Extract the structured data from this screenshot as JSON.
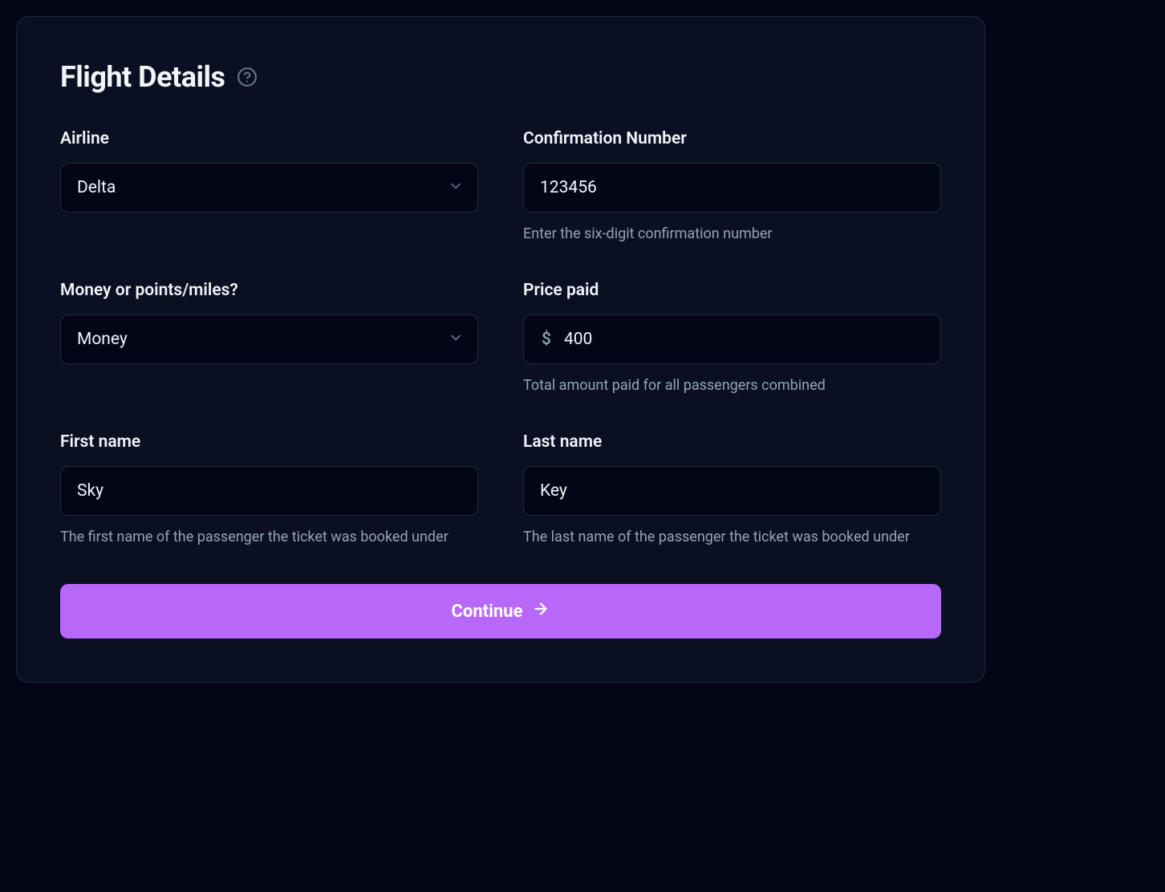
{
  "header": {
    "title": "Flight Details"
  },
  "fields": {
    "airline": {
      "label": "Airline",
      "value": "Delta"
    },
    "confirmation": {
      "label": "Confirmation Number",
      "value": "123456",
      "help": "Enter the six-digit confirmation number"
    },
    "payment_type": {
      "label": "Money or points/miles?",
      "value": "Money"
    },
    "price": {
      "label": "Price paid",
      "prefix": "$",
      "value": "400",
      "help": "Total amount paid for all passengers combined"
    },
    "first_name": {
      "label": "First name",
      "value": "Sky",
      "help": "The first name of the passenger the ticket was booked under"
    },
    "last_name": {
      "label": "Last name",
      "value": "Key",
      "help": "The last name of the passenger the ticket was booked under"
    }
  },
  "actions": {
    "continue": "Continue"
  }
}
